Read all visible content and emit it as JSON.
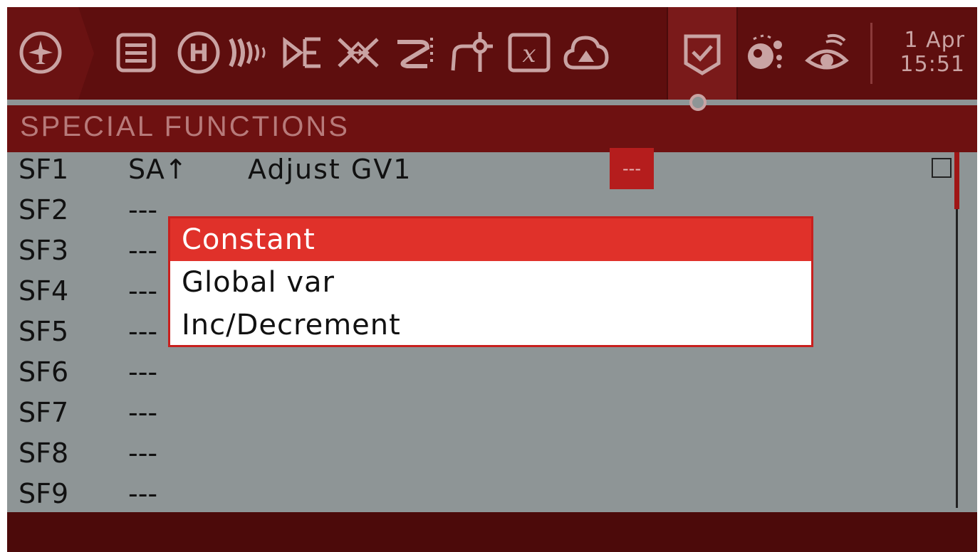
{
  "header": {
    "tabs": [
      {
        "icon": "airplane-icon"
      },
      {
        "icon": "list-icon"
      },
      {
        "icon": "heli-icon"
      },
      {
        "icon": "flight-modes-icon"
      },
      {
        "icon": "inputs-icon"
      },
      {
        "icon": "mixes-icon"
      },
      {
        "icon": "outputs-icon"
      },
      {
        "icon": "curves-icon"
      },
      {
        "icon": "global-vars-icon"
      },
      {
        "icon": "cloud-upload-icon"
      },
      {
        "icon": "special-functions-icon"
      },
      {
        "icon": "telemetry-sensor-icon"
      },
      {
        "icon": "display-eye-icon"
      }
    ],
    "date": "1 Apr",
    "time": "15:51"
  },
  "page": {
    "title": "SPECIAL FUNCTIONS"
  },
  "rows": [
    {
      "id": "SF1",
      "switch": "SA↑",
      "function": "Adjust  GV1",
      "value": "---"
    },
    {
      "id": "SF2",
      "switch": "---"
    },
    {
      "id": "SF3",
      "switch": "---"
    },
    {
      "id": "SF4",
      "switch": "---"
    },
    {
      "id": "SF5",
      "switch": "---"
    },
    {
      "id": "SF6",
      "switch": "---"
    },
    {
      "id": "SF7",
      "switch": "---"
    },
    {
      "id": "SF8",
      "switch": "---"
    },
    {
      "id": "SF9",
      "switch": "---"
    }
  ],
  "popup": {
    "options": [
      "Constant",
      "Global var",
      "Inc/Decrement"
    ],
    "selected_index": 0
  },
  "colors": {
    "header_bg": "#5e0e0e",
    "accent": "#e0312a",
    "list_bg": "#8e9596"
  }
}
